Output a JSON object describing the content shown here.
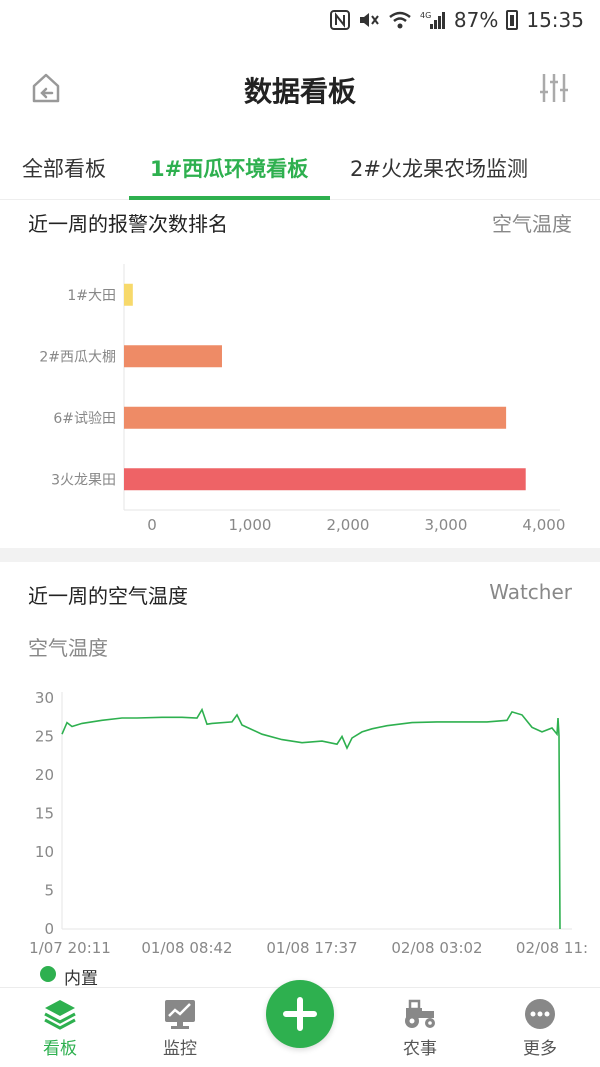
{
  "status_bar": {
    "battery": "87%",
    "time": "15:35",
    "network": "4G"
  },
  "header": {
    "title": "数据看板",
    "back_icon": "home-return-icon",
    "filter_icon": "sliders-icon"
  },
  "tabs": [
    {
      "label": "全部看板",
      "active": false
    },
    {
      "label": "1#西瓜环境看板",
      "active": true
    },
    {
      "label": "2#火龙果农场监测",
      "active": false
    }
  ],
  "card_alarm": {
    "title": "近一周的报警次数排名",
    "right_label": "空气温度"
  },
  "card_temp": {
    "title": "近一周的空气温度",
    "right_label": "Watcher",
    "subtitle": "空气温度",
    "legend": "内置"
  },
  "chart_data": [
    {
      "type": "bar",
      "orientation": "horizontal",
      "categories": [
        "1#大田",
        "2#西瓜大棚",
        "6#试验田",
        "3火龙果田"
      ],
      "values": [
        90,
        1000,
        3900,
        4100
      ],
      "colors": [
        "#f7d96b",
        "#ee8b66",
        "#ee8b66",
        "#ee6366"
      ],
      "xlim": [
        0,
        4500
      ],
      "xticks": [
        "0",
        "1,000",
        "2,000",
        "3,000",
        "4,000"
      ],
      "grid": false
    },
    {
      "type": "line",
      "series": [
        {
          "name": "内置",
          "color": "#2eb04f",
          "x": [
            0,
            1,
            2,
            4,
            8,
            12,
            15,
            20,
            24,
            27,
            28,
            29,
            30,
            34,
            35,
            36,
            40,
            44,
            48,
            52,
            55,
            56,
            57,
            58,
            60,
            62,
            65,
            70,
            75,
            80,
            85,
            89,
            90,
            92,
            94,
            96,
            98,
            99,
            99.2,
            99.4,
            99.6
          ],
          "values": [
            25.3,
            26.8,
            26.3,
            26.7,
            27.1,
            27.4,
            27.4,
            27.5,
            27.5,
            27.4,
            28.5,
            26.6,
            26.7,
            26.9,
            27.8,
            26.5,
            25.3,
            24.6,
            24.2,
            24.4,
            24.0,
            25.0,
            23.5,
            24.8,
            25.6,
            26.0,
            26.4,
            26.8,
            26.9,
            26.9,
            26.9,
            27.1,
            28.2,
            27.8,
            26.2,
            25.6,
            26.1,
            25.3,
            27.4,
            25.1,
            0
          ],
          "x_domain": [
            0,
            100
          ]
        }
      ],
      "ylim": [
        0,
        30
      ],
      "yticks": [
        "0",
        "5",
        "10",
        "15",
        "20",
        "25",
        "30"
      ],
      "xtick_labels": [
        "1/07 20:11",
        "01/08 08:42",
        "01/08 17:37",
        "02/08 03:02",
        "02/08 11:"
      ],
      "grid": false
    }
  ],
  "bottom_nav": [
    {
      "label": "看板",
      "icon": "layers-icon",
      "active": true
    },
    {
      "label": "监控",
      "icon": "monitor-icon",
      "active": false
    },
    {
      "label": "",
      "icon": "plus-icon",
      "active": false
    },
    {
      "label": "农事",
      "icon": "tractor-icon",
      "active": false
    },
    {
      "label": "更多",
      "icon": "more-icon",
      "active": false
    }
  ]
}
